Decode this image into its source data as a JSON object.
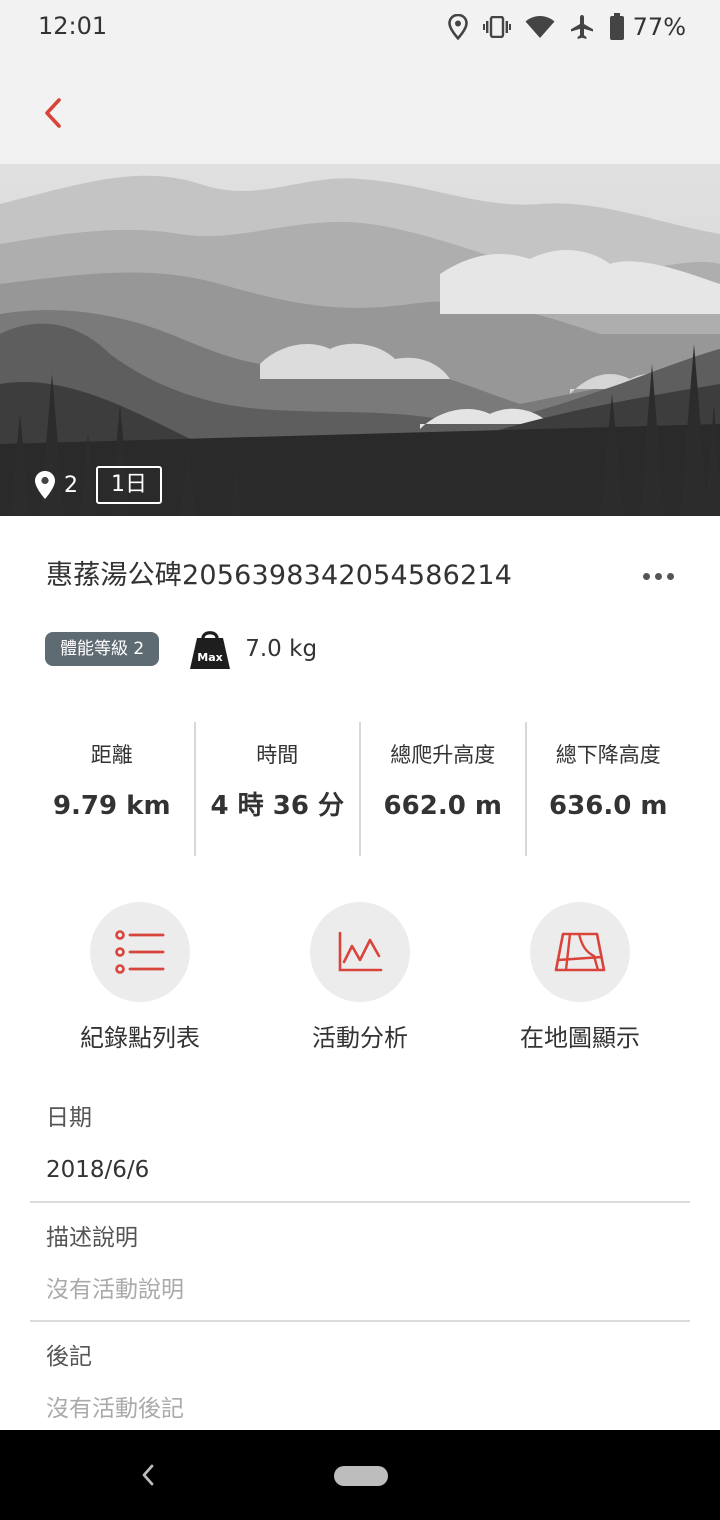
{
  "status_bar": {
    "time": "12:01",
    "battery": "77%",
    "icons": [
      "location-icon",
      "vibrate-icon",
      "wifi-icon",
      "airplane-icon",
      "battery-icon"
    ]
  },
  "hero": {
    "waypoint_count": "2",
    "duration_badge": "1日"
  },
  "trip": {
    "title": "惠蓀湯公碑2056398342054586214",
    "level": "體能等級 2",
    "max_icon_text": "Max",
    "weight": "7.0 kg"
  },
  "stats": [
    {
      "label": "距離",
      "value": "9.79 km"
    },
    {
      "label": "時間",
      "value": "4 時 36 分"
    },
    {
      "label": "總爬升高度",
      "value": "662.0 m"
    },
    {
      "label": "總下降高度",
      "value": "636.0 m"
    }
  ],
  "actions": [
    {
      "label": "紀錄點列表",
      "icon": "list-icon"
    },
    {
      "label": "活動分析",
      "icon": "chart-icon"
    },
    {
      "label": "在地圖顯示",
      "icon": "map-icon"
    }
  ],
  "details": {
    "date_label": "日期",
    "date_value": "2018/6/6",
    "description_label": "描述說明",
    "description_placeholder": "沒有活動說明",
    "notes_label": "後記",
    "notes_placeholder": "沒有活動後記"
  },
  "colors": {
    "accent": "#d9443a",
    "badge": "#5f6b73",
    "topbar": "#f2f2f2"
  }
}
